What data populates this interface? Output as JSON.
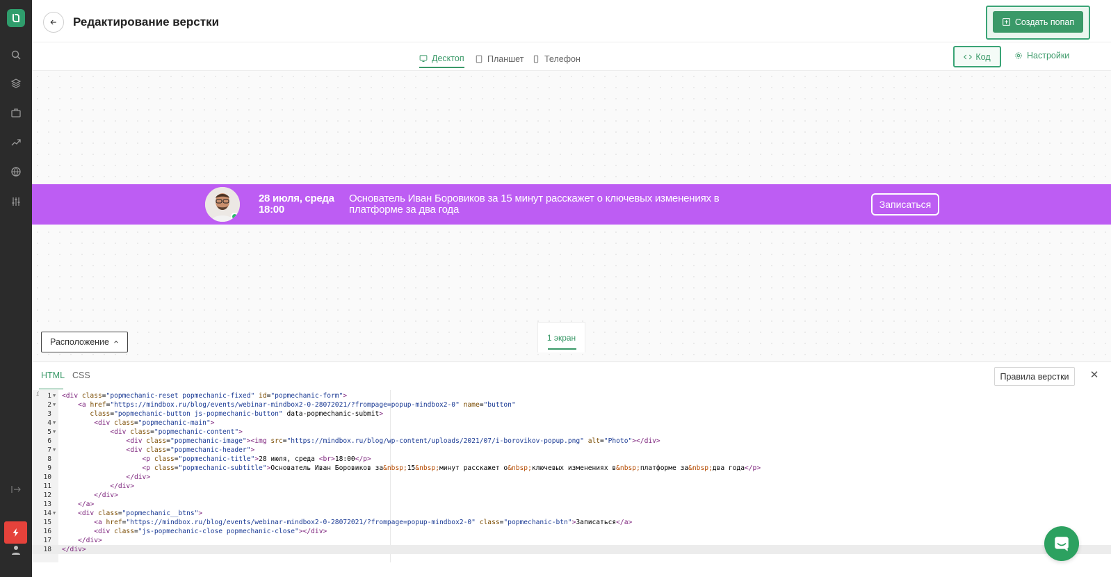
{
  "header": {
    "title": "Редактирование верстки",
    "create_button": "Создать попап"
  },
  "device_tabs": [
    {
      "label": "Десктоп",
      "icon": "monitor-icon",
      "active": true
    },
    {
      "label": "Планшет",
      "icon": "tablet-icon",
      "active": false
    },
    {
      "label": "Телефон",
      "icon": "phone-icon",
      "active": false
    }
  ],
  "toolbar": {
    "code_label": "Код",
    "settings_label": "Настройки"
  },
  "banner": {
    "title": "28 июля, среда 18:00",
    "subtitle": "Основатель Иван Боровиков за 15 минут расскажет о ключевых изменениях в платформе за два года",
    "button_label": "Записаться",
    "background_color": "#bd5df3"
  },
  "canvas": {
    "layout_button": "Расположение",
    "screen_tab": "1 экран"
  },
  "panel": {
    "tabs": [
      {
        "label": "HTML",
        "active": true
      },
      {
        "label": "CSS",
        "active": false
      }
    ],
    "rules_button": "Правила верстки"
  },
  "code_lines": [
    "<div class=\"popmechanic-reset popmechanic-fixed\" id=\"popmechanic-form\">",
    "    <a href=\"https://mindbox.ru/blog/events/webinar-mindbox2-0-28072021/?frompage=popup-mindbox2-0\" name=\"button\"",
    "       class=\"popmechanic-button js-popmechanic-button\" data-popmechanic-submit>",
    "        <div class=\"popmechanic-main\">",
    "            <div class=\"popmechanic-content\">",
    "                <div class=\"popmechanic-image\"><img src=\"https://mindbox.ru/blog/wp-content/uploads/2021/07/i-borovikov-popup.png\" alt=\"Photo\"></div>",
    "                <div class=\"popmechanic-header\">",
    "                    <p class=\"popmechanic-title\">28 июля, среда <br>18:00</p>",
    "                    <p class=\"popmechanic-subtitle\">Основатель Иван Боровиков за&nbsp;15&nbsp;минут расскажет о&nbsp;ключевых изменениях в&nbsp;платформе за&nbsp;два года</p>",
    "                </div>",
    "            </div>",
    "        </div>",
    "    </a>",
    "    <div class=\"popmechanic__btns\">",
    "        <a href=\"https://mindbox.ru/blog/events/webinar-mindbox2-0-28072021/?frompage=popup-mindbox2-0\" class=\"popmechanic-btn\">Записаться</a>",
    "        <div class=\"js-popmechanic-close popmechanic-close\"></div>",
    "    </div>",
    "</div>"
  ],
  "folded_lines": [
    1,
    2,
    4,
    5,
    7,
    14
  ],
  "active_line": 18,
  "colors": {
    "accent": "#3a9968",
    "sidebar": "#2b2b2b",
    "alert": "#e5423b"
  }
}
